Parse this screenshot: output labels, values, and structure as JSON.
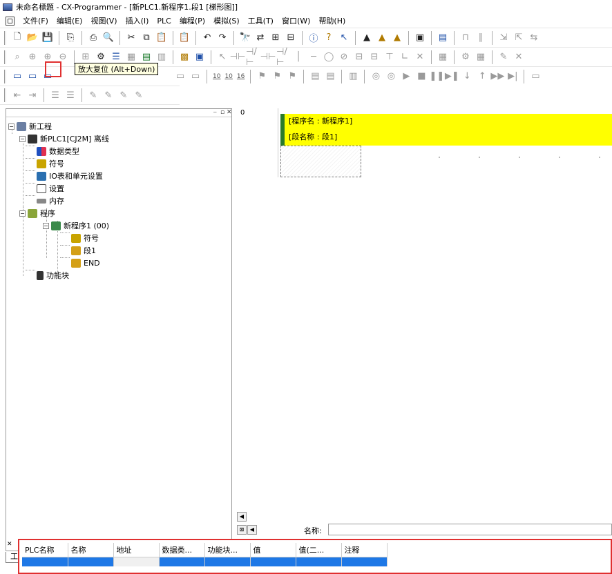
{
  "window": {
    "title": "未命名標題 - CX-Programmer - [新PLC1.新程序1.段1 [梯形图]]"
  },
  "menu": [
    "文件(F)",
    "编辑(E)",
    "视图(V)",
    "插入(I)",
    "PLC",
    "编程(P)",
    "模拟(S)",
    "工具(T)",
    "窗口(W)",
    "帮助(H)"
  ],
  "toolbar": {
    "zoom_numbers": [
      "10",
      "10",
      "16"
    ],
    "tooltip": "放大复位 (Alt+Down)"
  },
  "project_tree": {
    "root": "新工程",
    "plc": "新PLC1[CJ2M] 离线",
    "data_types": "数据类型",
    "symbols": "符号",
    "io_table": "IO表和单元设置",
    "settings": "设置",
    "memory": "内存",
    "programs": "程序",
    "program1": "新程序1 (00)",
    "program_symbols": "符号",
    "section1": "段1",
    "end": "END",
    "function_blocks": "功能块",
    "tab_label": "工程"
  },
  "ladder": {
    "rung_number": "0",
    "program_name_line": "[程序名 : 新程序1]",
    "section_name_line": "[段名称 : 段1]",
    "name_label": "名称:"
  },
  "watch_window": {
    "columns": [
      "PLC名称",
      "名称",
      "地址",
      "数据类...",
      "功能块...",
      "值",
      "值(二...",
      "注释"
    ]
  },
  "colors": {
    "highlight": "#e03030",
    "header_bar": "#ffff00",
    "header_accent": "#2a7a2a",
    "selection_blue": "#1e78e6",
    "tooltip_bg": "#ffffe1"
  }
}
